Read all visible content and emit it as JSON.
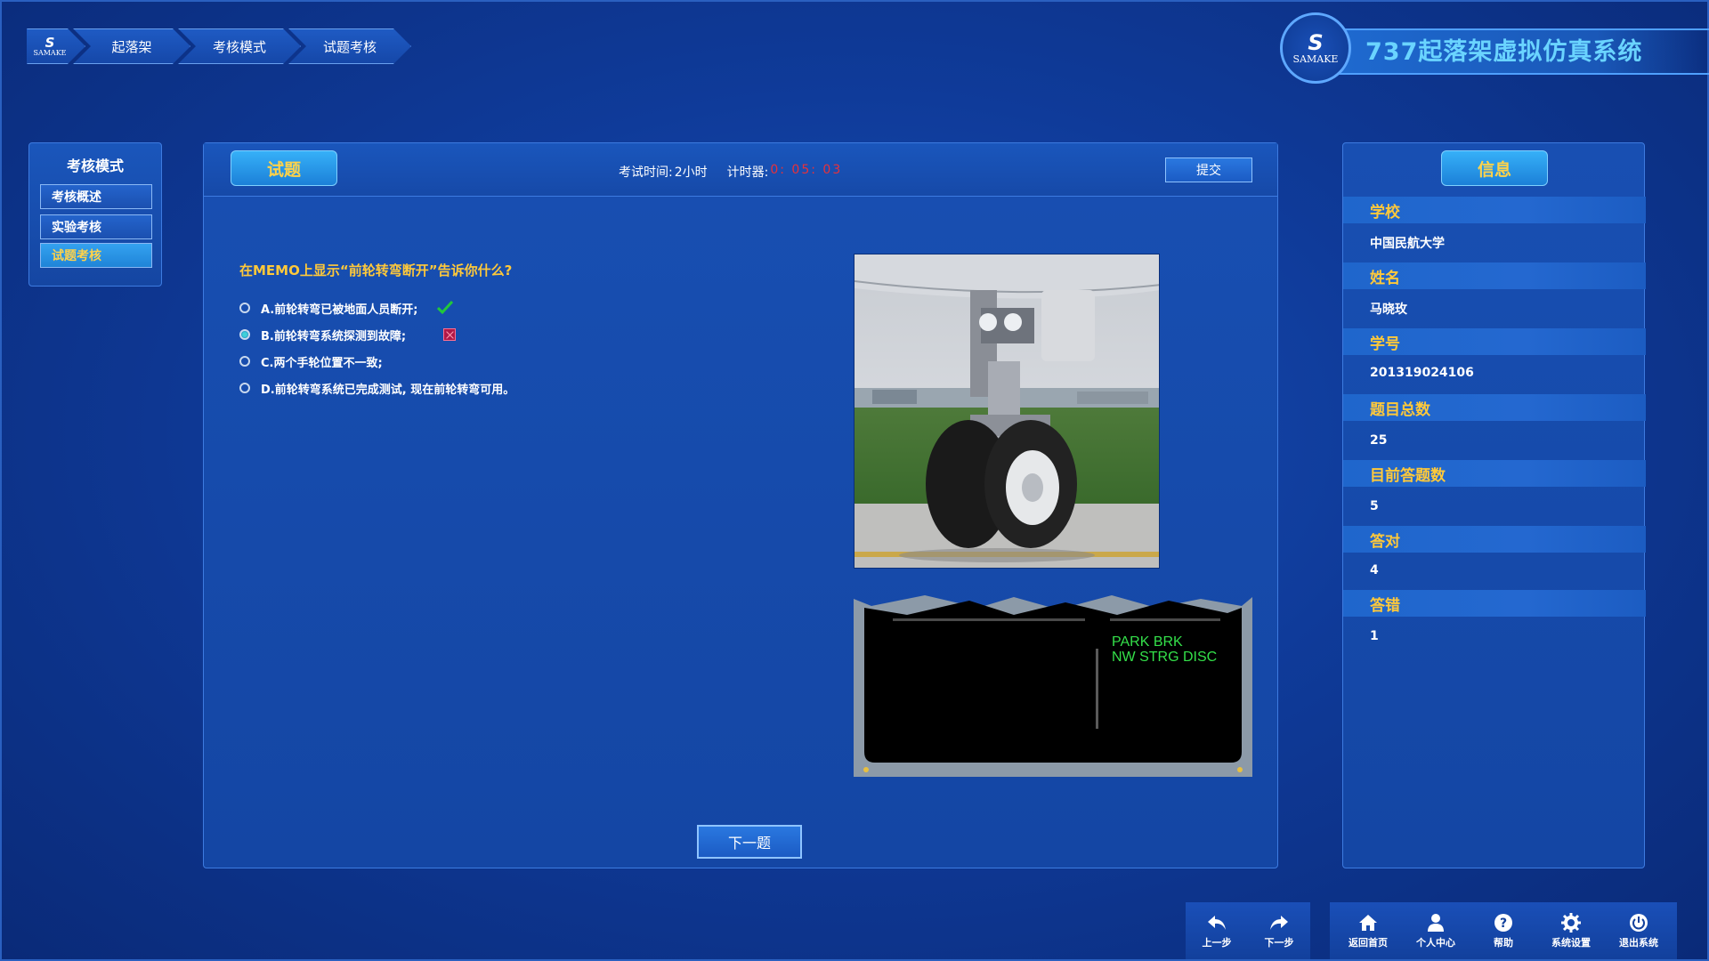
{
  "breadcrumb": {
    "logo_mark": "S",
    "logo_text": "SAMAKE",
    "items": [
      "起落架",
      "考核模式",
      "试题考核"
    ]
  },
  "header": {
    "logo_mark": "S",
    "logo_text": "SAMAKE",
    "app_title": "737起落架虚拟仿真系统"
  },
  "left_nav": {
    "title": "考核模式",
    "items": [
      {
        "label": "考核概述",
        "active": false
      },
      {
        "label": "实验考核",
        "active": false
      },
      {
        "label": "试题考核",
        "active": true
      }
    ]
  },
  "exam": {
    "tab_label": "试题",
    "time_label": "考试时间:",
    "time_value": "2小时",
    "timer_label": "计时器:",
    "timer_value": "0: 05: 03",
    "submit_label": "提交",
    "question": "在MEMO上显示“前轮转弯断开”告诉你什么?",
    "options": [
      {
        "label": "A.前轮转弯已被地面人员断开;",
        "selected": false,
        "mark": "check"
      },
      {
        "label": "B.前轮转弯系统探测到故障;",
        "selected": true,
        "mark": "wrong"
      },
      {
        "label": "C.两个手轮位置不一致;",
        "selected": false,
        "mark": ""
      },
      {
        "label": "D.前轮转弯系统已完成测试, 现在前轮转弯可用。",
        "selected": false,
        "mark": ""
      }
    ],
    "memo_lines": [
      "PARK BRK",
      "NW STRG DISC"
    ],
    "next_label": "下一题"
  },
  "info": {
    "title": "信息",
    "rows": [
      {
        "label": "学校",
        "value": "中国民航大学"
      },
      {
        "label": "姓名",
        "value": "马晓玫"
      },
      {
        "label": "学号",
        "value": "201319024106"
      },
      {
        "label": "题目总数",
        "value": "25"
      },
      {
        "label": "目前答题数",
        "value": "5"
      },
      {
        "label": "答对",
        "value": "4"
      },
      {
        "label": "答错",
        "value": "1"
      }
    ]
  },
  "toolbar": {
    "back": "上一步",
    "forward": "下一步",
    "home": "返回首页",
    "profile": "个人中心",
    "help": "帮助",
    "settings": "系统设置",
    "exit": "退出系统"
  },
  "colors": {
    "accent_yellow": "#ffc93a",
    "timer_red": "#e8303a",
    "memo_green": "#34e04a"
  }
}
